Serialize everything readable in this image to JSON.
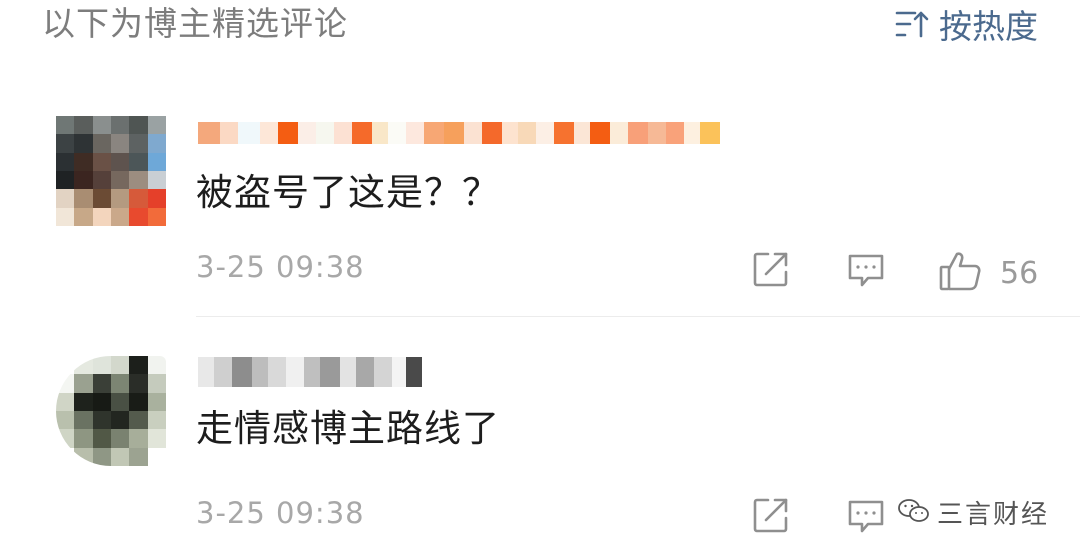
{
  "header": {
    "title": "以下为博主精选评论",
    "sort_label": "按热度",
    "sort_icon": "sort-icon"
  },
  "comments": [
    {
      "text": "被盗号了这是？？",
      "time": "3-25 09:38",
      "likes": "56",
      "username_redacted": true,
      "avatar_pixelated": true
    },
    {
      "text": "走情感博主路线了",
      "time": "3-25 09:38",
      "username_redacted": true,
      "avatar_pixelated": true
    }
  ],
  "icons": {
    "repost": "repost-icon",
    "reply": "comment-icon",
    "like": "thumbs-up-icon",
    "watermark": "wechat-icon"
  },
  "colors": {
    "header_text": "#7d7d7d",
    "sort_accent": "#4b6a8e",
    "comment_text": "#1d1d1d",
    "meta_text": "#a8a8a8",
    "icon_gray": "#8f8f8f"
  },
  "watermark": {
    "text": "三言财经"
  }
}
